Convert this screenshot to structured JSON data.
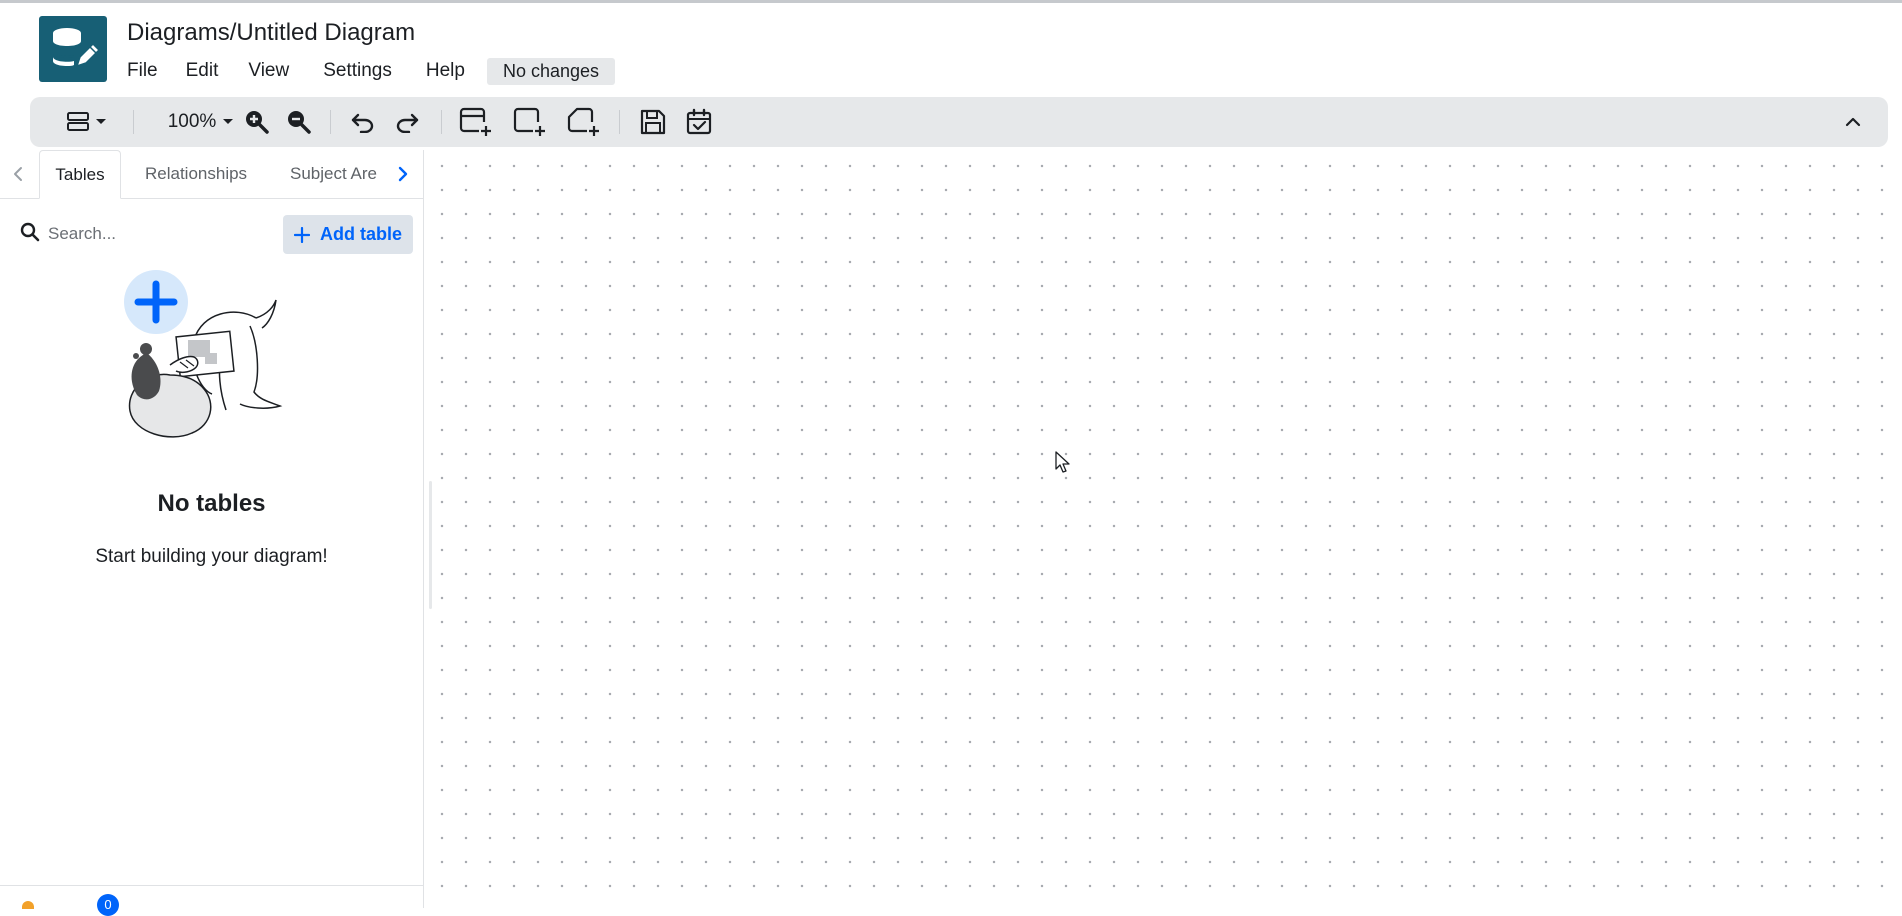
{
  "header": {
    "title": "Diagrams/Untitled Diagram",
    "status": "No changes",
    "menu": [
      {
        "label": "File"
      },
      {
        "label": "Edit"
      },
      {
        "label": "View"
      },
      {
        "label": "Settings"
      },
      {
        "label": "Help"
      }
    ]
  },
  "toolbar": {
    "zoom_label": "100%",
    "icons": [
      "layout-icon",
      "zoom-in-icon",
      "zoom-out-icon",
      "undo-icon",
      "redo-icon",
      "add-table-icon",
      "add-area-icon",
      "add-note-icon",
      "save-icon",
      "todo-icon",
      "collapse-icon"
    ]
  },
  "sidebar": {
    "tabs": [
      {
        "label": "Tables",
        "active": true
      },
      {
        "label": "Relationships",
        "active": false
      },
      {
        "label": "Subject Are",
        "active": false
      }
    ],
    "search": {
      "placeholder": "Search..."
    },
    "add_button": "Add table",
    "empty_title": "No tables",
    "empty_subtitle": "Start building your diagram!",
    "issues_count": "0"
  },
  "colors": {
    "brand": "#175f75",
    "accent": "#0064fa",
    "toolbar_bg": "#e6e8ea",
    "grid_dot": "#a8abb0"
  }
}
